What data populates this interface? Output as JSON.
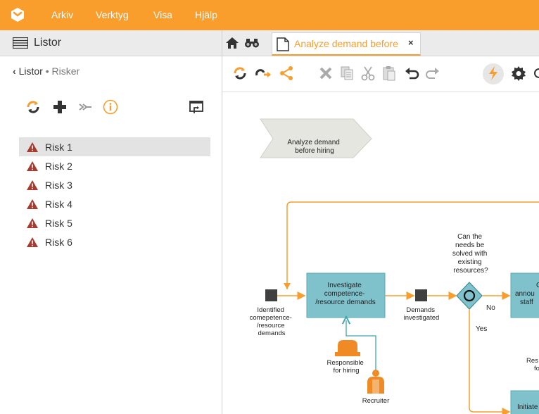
{
  "menu": {
    "items": [
      "Arkiv",
      "Verktyg",
      "Visa",
      "Hjälp"
    ]
  },
  "left_panel": {
    "header": "Listor",
    "breadcrumb": {
      "parent": "Listor",
      "separator": "•",
      "current": "Risker"
    },
    "risks": [
      "Risk 1",
      "Risk 2",
      "Risk 3",
      "Risk 4",
      "Risk 5",
      "Risk 6"
    ],
    "selected_index": 0
  },
  "tabs": {
    "active_title": "Analyze demand before",
    "close_label": "×"
  },
  "diagram": {
    "header_shape": [
      "Analyze demand",
      "before hiring"
    ],
    "event_start": [
      "Identified",
      "comepetence-",
      "/resource",
      "demands"
    ],
    "task_investigate": [
      "Investigate",
      "competence-",
      "/resource demands"
    ],
    "event_investigated": [
      "Demands",
      "investigated"
    ],
    "gateway_question": [
      "Can the",
      "needs be",
      "solved with",
      "existing",
      "resources?"
    ],
    "label_no": "No",
    "label_yes": "Yes",
    "role_responsible": [
      "Responsible",
      "for hiring"
    ],
    "role_recruiter": "Recruiter",
    "task_announce_partial": [
      "C",
      "annou",
      "staff"
    ],
    "responsible_partial": [
      "Res",
      "fo"
    ],
    "task_initiate_partial": "Initiate"
  },
  "colors": {
    "brand": "#f99d2d",
    "task_fill": "#7fc2cc",
    "connector": "#f99d2d",
    "association": "#3fa6ad"
  }
}
